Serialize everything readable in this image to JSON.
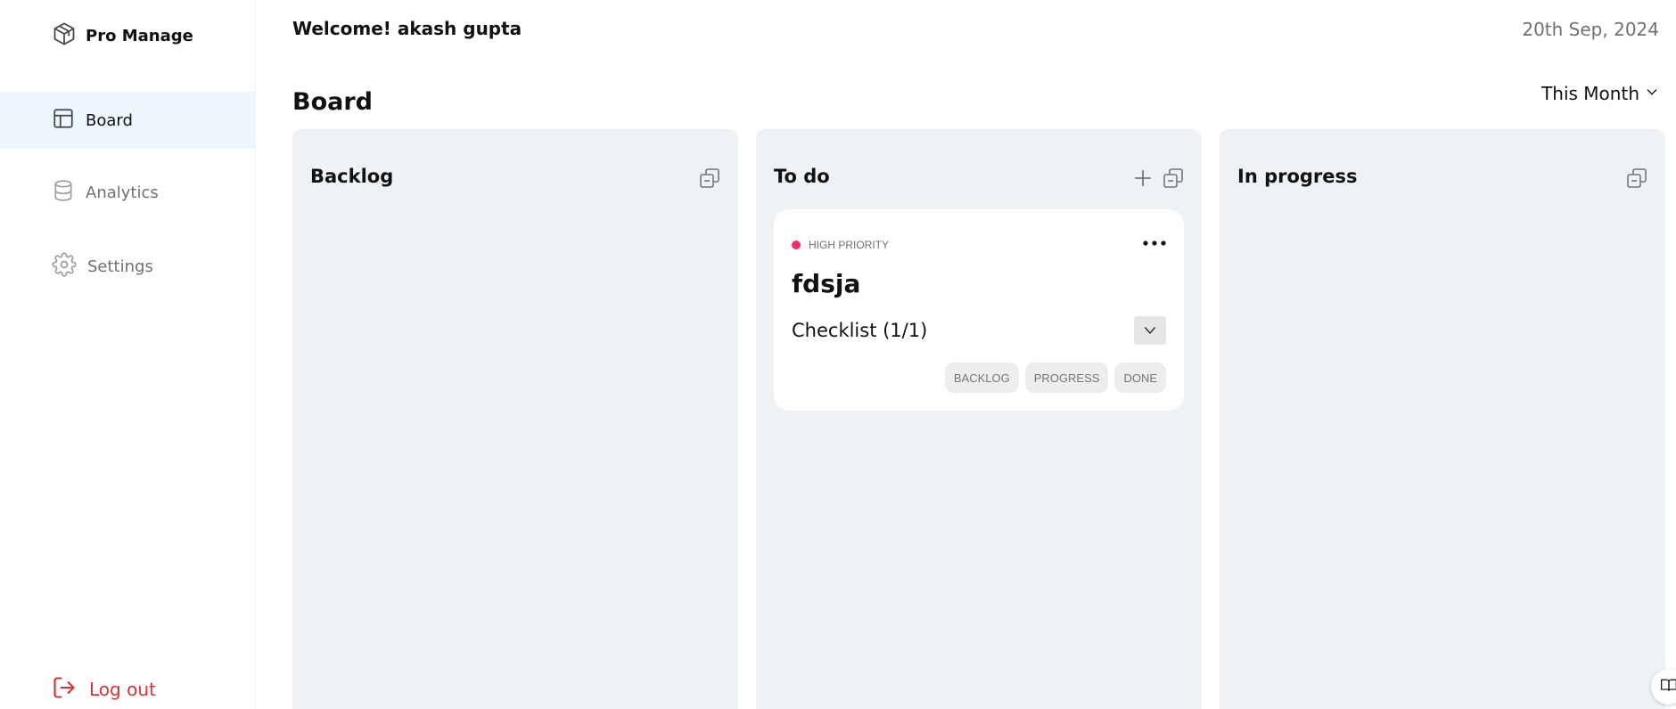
{
  "sidebar": {
    "brand": "Pro Manage",
    "items": [
      {
        "label": "Board",
        "icon": "layout-icon",
        "active": true
      },
      {
        "label": "Analytics",
        "icon": "database-icon",
        "active": false
      },
      {
        "label": "Settings",
        "icon": "gear-icon",
        "active": false
      }
    ],
    "logout_label": "Log out"
  },
  "header": {
    "welcome": "Welcome! akash gupta",
    "date": "20th Sep, 2024",
    "title": "Board",
    "filter_label": "This Month"
  },
  "columns": [
    {
      "title": "Backlog"
    },
    {
      "title": "To do"
    },
    {
      "title": "In progress"
    }
  ],
  "card": {
    "priority": "HIGH PRIORITY",
    "title": "fdsja",
    "checklist": "Checklist (1/1)",
    "chips": [
      "BACKLOG",
      "PROGRESS",
      "DONE"
    ]
  },
  "colors": {
    "accent_active": "#eef6ff",
    "column_bg": "#eef2f5",
    "priority_high": "#ff2473",
    "logout": "#cf3636"
  }
}
